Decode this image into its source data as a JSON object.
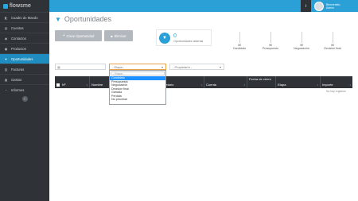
{
  "app": {
    "name": "flowsme"
  },
  "sidebar": {
    "items": [
      {
        "label": "Cuadro de Mando",
        "icon": "dashboard-icon",
        "active": false
      },
      {
        "label": "Cuentas",
        "icon": "accounts-icon",
        "active": false
      },
      {
        "label": "Contactos",
        "icon": "contacts-icon",
        "active": false
      },
      {
        "label": "Productos",
        "icon": "products-icon",
        "active": false
      },
      {
        "label": "Oportunidades",
        "icon": "funnel-icon",
        "active": true
      },
      {
        "label": "Facturas",
        "icon": "invoices-icon",
        "active": false
      },
      {
        "label": "Gastos",
        "icon": "expenses-icon",
        "active": false
      },
      {
        "label": "Informes",
        "icon": "reports-icon",
        "active": false
      }
    ],
    "collapse_glyph": "‹"
  },
  "topbar": {
    "info_glyph": "i",
    "user_greeting": "Bienvenido,",
    "user_name": "Admin"
  },
  "page": {
    "title": "Oportunidades"
  },
  "buttons": {
    "new_label": "Crear Oportunidad",
    "delete_label": "Eliminar"
  },
  "summary": {
    "count": "0",
    "label": "Oportunidades abiertas"
  },
  "stages": [
    {
      "value": "0€",
      "label": "Candidato"
    },
    {
      "value": "0€",
      "label": "Presupuesto"
    },
    {
      "value": "0€",
      "label": "Negociación"
    },
    {
      "value": "0€",
      "label": "Decisión final"
    }
  ],
  "filters": {
    "etapa_value": "- Etapa -",
    "propietario_value": "- Propietario -"
  },
  "table": {
    "columns": [
      "Nº",
      "Nombre",
      "Propietario",
      "Cuenta",
      "Fecha de cierre",
      "Etapa",
      "Importe"
    ],
    "empty_text": "No hay registros"
  },
  "dropdown": {
    "search_placeholder": "- Etapa -",
    "options": [
      "Candidato",
      "Presupuesto",
      "Negociación",
      "Decisión final",
      "Ganada",
      "Perdida",
      "No procesar"
    ],
    "highlighted": "Candidato"
  }
}
